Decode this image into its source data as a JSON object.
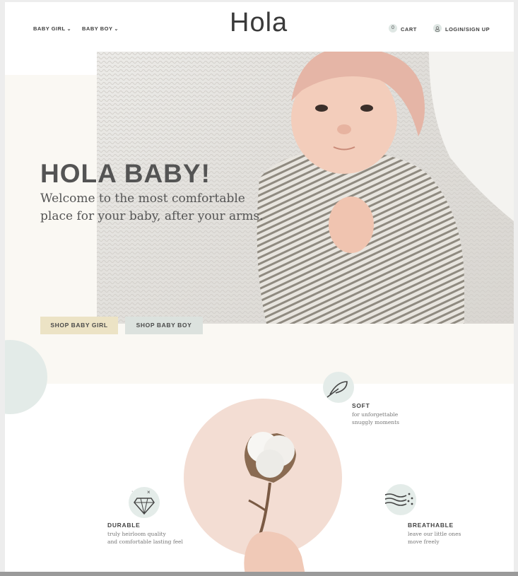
{
  "header": {
    "nav": [
      {
        "label": "BABY GIRL"
      },
      {
        "label": "BABY BOY"
      }
    ],
    "logo": "Hola",
    "cart": {
      "count": "0",
      "label": "CART"
    },
    "login_label": "LOGIN/SIGN UP",
    "chevron": "⌄"
  },
  "hero": {
    "headline": "HOLA BABY!",
    "subtitle": "Welcome to the most comfortable place for your baby, after your arms.",
    "buttons": {
      "girl": "SHOP BABY GIRL",
      "boy": "SHOP BABY BOY"
    }
  },
  "features": [
    {
      "title": "SOFT",
      "desc_line1": "for unforgettable",
      "desc_line2": "snuggly moments",
      "icon": "feather-icon"
    },
    {
      "title": "DURABLE",
      "desc_line1": "truly heirloom quality",
      "desc_line2": "and comfortable lasting feel",
      "icon": "diamond-icon"
    },
    {
      "title": "BREATHABLE",
      "desc_line1": "leave our little ones",
      "desc_line2": "move freely",
      "icon": "wind-icon"
    }
  ],
  "colors": {
    "accent_girl": "#ece3c5",
    "accent_boy": "#dce2de",
    "mint": "#e4ece9",
    "peach": "#f3ddd3",
    "cream": "#faf8f3"
  }
}
